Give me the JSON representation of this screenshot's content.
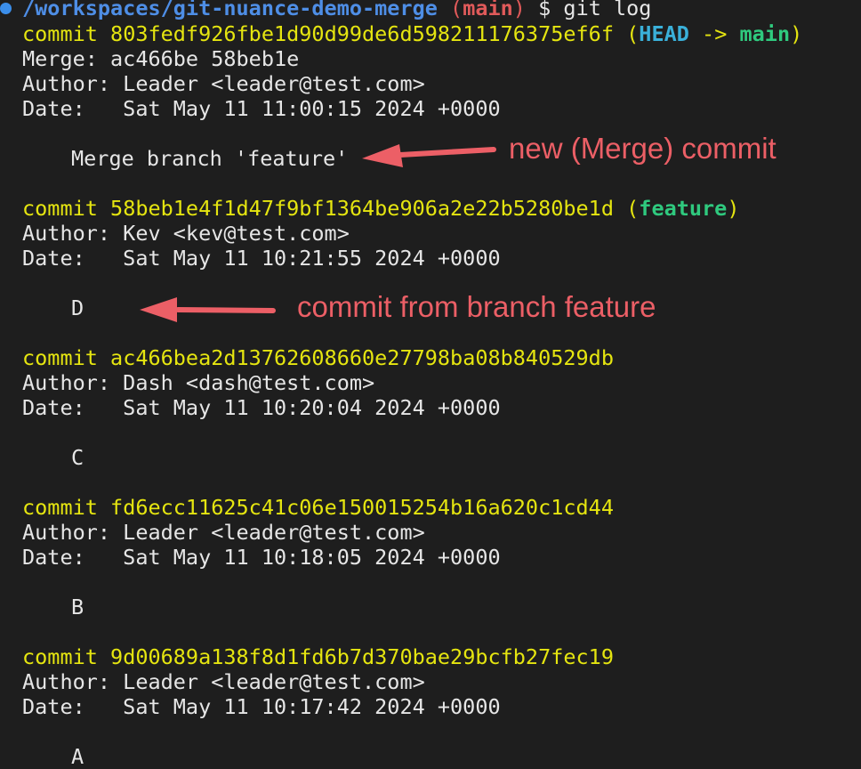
{
  "prompt": {
    "path": "/workspaces/git-nuance-demo-merge",
    "branch": "main",
    "symbol": "$",
    "command": "git log"
  },
  "commits": [
    {
      "label": "commit",
      "hash": "803fedf926fbe1d90d99de6d598211176375ef6f",
      "refs": {
        "head": "HEAD",
        "arrow": "->",
        "branch": "main"
      },
      "merge": "Merge: ac466be 58beb1e",
      "author": "Author: Leader <leader@test.com>",
      "date": "Date:   Sat May 11 11:00:15 2024 +0000",
      "message": "Merge branch 'feature'"
    },
    {
      "label": "commit",
      "hash": "58beb1e4f1d47f9bf1364be906a2e22b5280be1d",
      "refs": {
        "branch": "feature"
      },
      "author": "Author: Kev <kev@test.com>",
      "date": "Date:   Sat May 11 10:21:55 2024 +0000",
      "message": "D"
    },
    {
      "label": "commit",
      "hash": "ac466bea2d13762608660e27798ba08b840529db",
      "author": "Author: Dash <dash@test.com>",
      "date": "Date:   Sat May 11 10:20:04 2024 +0000",
      "message": "C"
    },
    {
      "label": "commit",
      "hash": "fd6ecc11625c41c06e150015254b16a620c1cd44",
      "author": "Author: Leader <leader@test.com>",
      "date": "Date:   Sat May 11 10:18:05 2024 +0000",
      "message": "B"
    },
    {
      "label": "commit",
      "hash": "9d00689a138f8d1fd6b7d370bae29bcfb27fec19",
      "author": "Author: Leader <leader@test.com>",
      "date": "Date:   Sat May 11 10:17:42 2024 +0000",
      "message": "A"
    }
  ],
  "annotations": {
    "merge_commit": "new (Merge) commit",
    "feature_commit": "commit from branch feature"
  },
  "colors": {
    "background": "#1e1e1e",
    "hash": "#e5e510",
    "head": "#3ab0d9",
    "branch_ref": "#2fc97e",
    "path": "#4e8ee6",
    "annotation": "#ec5f66"
  }
}
